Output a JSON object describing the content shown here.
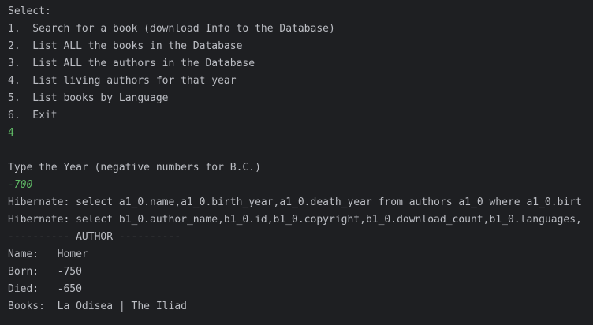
{
  "console": {
    "lines": [
      {
        "text": "Select:",
        "kind": "output"
      },
      {
        "text": "1.  Search for a book (download Info to the Database)",
        "kind": "output"
      },
      {
        "text": "2.  List ALL the books in the Database",
        "kind": "output"
      },
      {
        "text": "3.  List ALL the authors in the Database",
        "kind": "output"
      },
      {
        "text": "4.  List living authors for that year",
        "kind": "output"
      },
      {
        "text": "5.  List books by Language",
        "kind": "output"
      },
      {
        "text": "6.  Exit",
        "kind": "output"
      },
      {
        "text": "4",
        "kind": "input"
      },
      {
        "text": "",
        "kind": "output"
      },
      {
        "text": "Type the Year (negative numbers for B.C.)",
        "kind": "output"
      },
      {
        "text": "-700",
        "kind": "input-italic"
      },
      {
        "text": "Hibernate: select a1_0.name,a1_0.birth_year,a1_0.death_year from authors a1_0 where a1_0.birt",
        "kind": "output"
      },
      {
        "text": "Hibernate: select b1_0.author_name,b1_0.id,b1_0.copyright,b1_0.download_count,b1_0.languages,",
        "kind": "output"
      },
      {
        "text": "---------- AUTHOR ----------",
        "kind": "output"
      },
      {
        "text": "Name:   Homer",
        "kind": "output"
      },
      {
        "text": "Born:   -750",
        "kind": "output"
      },
      {
        "text": "Died:   -650",
        "kind": "output"
      },
      {
        "text": "Books:  La Odisea | The Iliad",
        "kind": "output"
      }
    ],
    "colors": {
      "background": "#1e1f22",
      "output_text": "#bcbec4",
      "user_input": "#5fb865"
    }
  }
}
